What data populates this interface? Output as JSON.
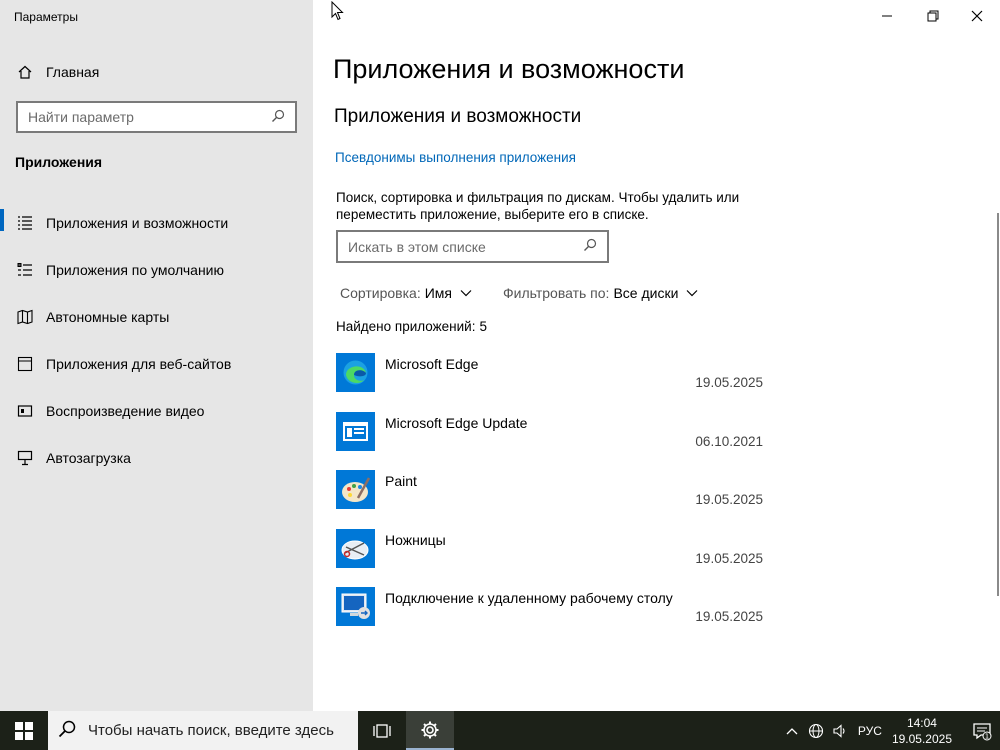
{
  "window": {
    "title": "Параметры"
  },
  "sidebar": {
    "home_label": "Главная",
    "search_placeholder": "Найти параметр",
    "section_title": "Приложения",
    "items": [
      {
        "label": "Приложения и возможности",
        "icon": "apps-list-icon",
        "active": true
      },
      {
        "label": "Приложения по умолчанию",
        "icon": "default-apps-icon"
      },
      {
        "label": "Автономные карты",
        "icon": "offline-maps-icon"
      },
      {
        "label": "Приложения для веб-сайтов",
        "icon": "web-apps-icon"
      },
      {
        "label": "Воспроизведение видео",
        "icon": "video-playback-icon"
      },
      {
        "label": "Автозагрузка",
        "icon": "startup-icon"
      }
    ]
  },
  "main": {
    "page_title": "Приложения и возможности",
    "section_title": "Приложения и возможности",
    "aliases_link": "Псевдонимы выполнения приложения",
    "description": "Поиск, сортировка и фильтрация по дискам. Чтобы удалить или переместить приложение, выберите его в списке.",
    "list_search_placeholder": "Искать в этом списке",
    "sort_label": "Сортировка:",
    "sort_value": "Имя",
    "filter_label": "Фильтровать по:",
    "filter_value": "Все диски",
    "count_label": "Найдено приложений:",
    "count_value": "5",
    "apps": [
      {
        "name": "Microsoft Edge",
        "date": "19.05.2025",
        "icon": "edge-icon"
      },
      {
        "name": "Microsoft Edge Update",
        "date": "06.10.2021",
        "icon": "edge-update-icon"
      },
      {
        "name": "Paint",
        "date": "19.05.2025",
        "icon": "paint-icon"
      },
      {
        "name": "Ножницы",
        "date": "19.05.2025",
        "icon": "snipping-tool-icon"
      },
      {
        "name": "Подключение к удаленному рабочему столу",
        "date": "19.05.2025",
        "icon": "remote-desktop-icon"
      }
    ]
  },
  "taskbar": {
    "search_placeholder": "Чтобы начать поиск, введите здесь",
    "language": "РУС",
    "time": "14:04",
    "date": "19.05.2025",
    "notification_count": "1"
  },
  "colors": {
    "accent": "#0067c0",
    "link": "#0067b8",
    "sidebar_bg": "#e6e6e6",
    "taskbar_bg": "#1c2118"
  }
}
